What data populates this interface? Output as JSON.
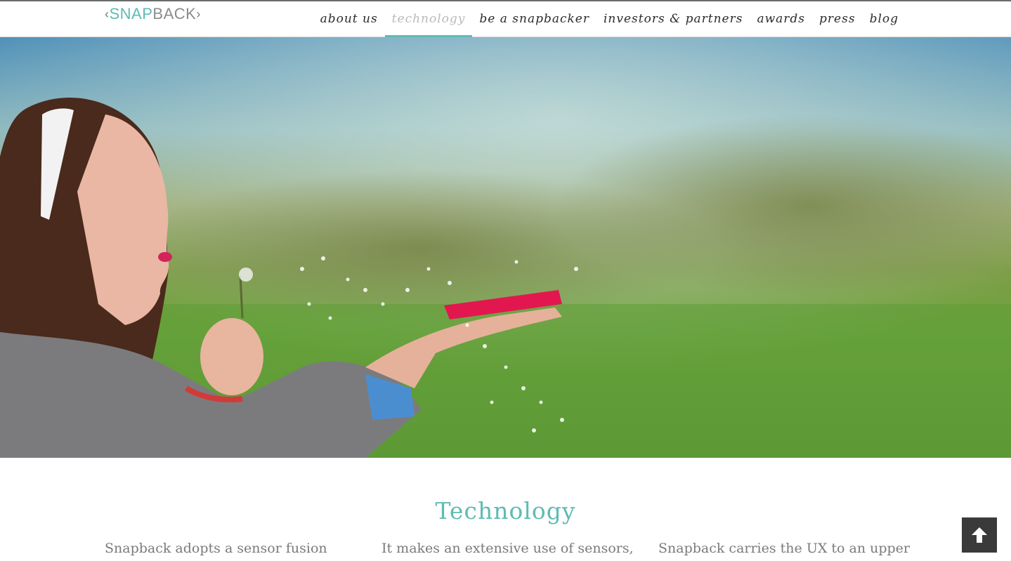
{
  "brand": {
    "chevron_left": "‹",
    "snap": "SNAP",
    "back": "BACK",
    "chevron_right": "›",
    "color_primary": "#5dbcb3",
    "color_secondary": "#8c8c8c"
  },
  "nav": {
    "items": [
      {
        "label": "about us",
        "active": false
      },
      {
        "label": "technology",
        "active": true
      },
      {
        "label": "be a snapbacker",
        "active": false
      },
      {
        "label": "investors & partners",
        "active": false
      },
      {
        "label": "awards",
        "active": false
      },
      {
        "label": "press",
        "active": false
      },
      {
        "label": "blog",
        "active": false
      }
    ],
    "active_color": "#5dbcb3"
  },
  "hero": {
    "image_icon": "hero-photo"
  },
  "technology": {
    "title": "Technology",
    "columns": [
      "Snapback adopts a sensor fusion",
      "It makes an extensive use of sensors,",
      "Snapback carries the UX to an upper"
    ]
  },
  "controls": {
    "scroll_top_icon": "arrow-up-icon"
  }
}
